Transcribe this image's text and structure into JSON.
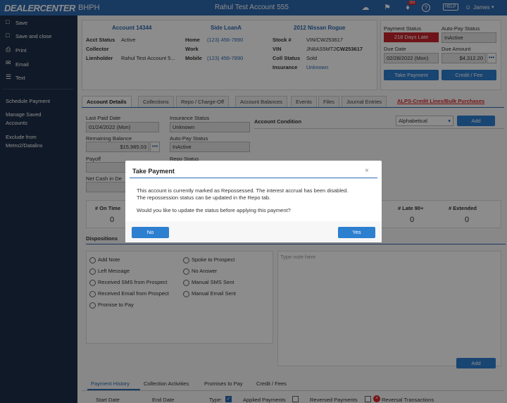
{
  "topbar": {
    "logo": "DEALERCENTER",
    "logo_suffix": "BHPH",
    "title": "Rahul Test Account 555",
    "notif_count": "303",
    "help": "HELP",
    "user": "James"
  },
  "sidebar": {
    "items": [
      "Save",
      "Save and close",
      "Print",
      "Email",
      "Text"
    ],
    "links": [
      "Schedule Payment",
      "Manage Saved",
      "Accounts",
      "Exclude from",
      "Metro2/Datalinx"
    ]
  },
  "account": {
    "header": "Account 14344",
    "status_label": "Acct Status",
    "status": "Active",
    "collector_label": "Collector",
    "lienholder_label": "Lienholder",
    "lienholder": "Rahul Test Account 5...",
    "side_header": "Side LoanA",
    "home_label": "Home",
    "home": "(123) 456-7890",
    "work_label": "Work",
    "mobile_label": "Mobile",
    "mobile": "(123) 456-7890",
    "vehicle_header": "2012 Nissan Rogue",
    "stock_label": "Stock #",
    "stock": "VIN/CW253617",
    "vin_label": "VIN",
    "vin_prefix": "JN8AS5MT2",
    "vin_suffix": "CW253617",
    "coll_label": "Coll Status",
    "coll": "Sold",
    "ins_label": "Insurance",
    "ins": "Unknown"
  },
  "payment": {
    "status_label": "Payment Status",
    "status": "218 Days Late",
    "autopay_label": "Auto-Pay Status",
    "autopay": "InActive",
    "due_label": "Due Date",
    "due": "02/28/2022 (Mon)",
    "amount_label": "Due Amount",
    "amount": "$4,312.20",
    "take_payment": "Take Payment",
    "credit_fee": "Credit / Fee"
  },
  "tabs": [
    "Account Details",
    "Collections",
    "Repo / Charge-Off",
    "Account Balances",
    "Events",
    "Files",
    "Journal Entries"
  ],
  "alps_link": "ALPS-Credit Lines/Bulk Purchases",
  "details": {
    "last_paid_label": "Last Paid Date",
    "last_paid": "01/24/2022 (Mon)",
    "remaining_label": "Remaining Balance",
    "remaining": "$15,985.03",
    "payoff_label": "Payoff",
    "payoff_partial": "$1",
    "netcash_label": "Net Cash in De",
    "ins_status_label": "Insurance Status",
    "ins_status": "Unknown",
    "autopay_label": "Auto-Pay Status",
    "autopay": "InActive",
    "repo_label": "Repo Status"
  },
  "condition": {
    "label": "Account Condition",
    "select": "Alphabetical",
    "add": "Add"
  },
  "stats": [
    {
      "label": "# On Time",
      "value": "0"
    },
    {
      "label": "# Late 90+",
      "value": "0"
    },
    {
      "label": "# Extended",
      "value": "0"
    }
  ],
  "dispositions": {
    "label": "Dispositions",
    "left": [
      "Add Note",
      "Left Message",
      "Received SMS from Prospect",
      "Received Email from Prospect",
      "Promise to Pay"
    ],
    "right": [
      "Spoke to Prospect",
      "No Answer",
      "Manual SMS Sent",
      "Manual Email Sent"
    ],
    "note_placeholder": "Type note here",
    "add": "Add"
  },
  "bottom_tabs": [
    "Payment History",
    "Collection Activities",
    "Promises to Pay",
    "Credit / Fees"
  ],
  "filters": {
    "start": "Start Date",
    "end": "End Date",
    "type": "Type:",
    "applied": "Applied Payments",
    "reversed": "Reversed Payments",
    "reversal": "Reversal Transactions"
  },
  "modal": {
    "title": "Take Payment",
    "close": "×",
    "line1": "This account is currently marked as Repossessed. The interest accrual has been disabled.",
    "line2": "The repossession status can be updated in the Repo tab.",
    "question": "Would you like to update the status before applying this payment?",
    "no": "No",
    "yes": "Yes"
  },
  "colors": {
    "brand": "#2d69b0",
    "sidebar": "#1e2f47",
    "late": "#c9252c",
    "alps": "#d9252a"
  }
}
